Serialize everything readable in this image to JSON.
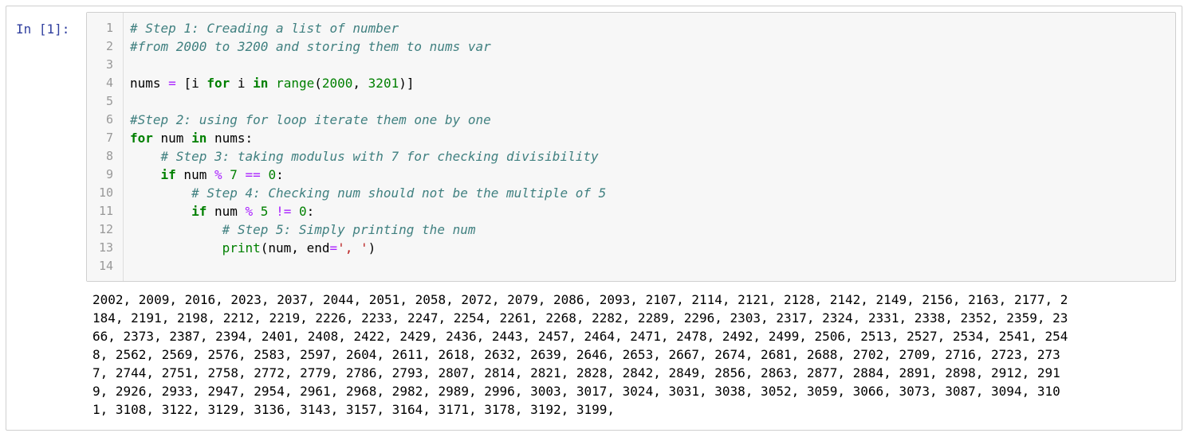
{
  "cell": {
    "prompt": "In [1]:"
  },
  "code": {
    "line_numbers": [
      "1",
      "2",
      "3",
      "4",
      "5",
      "6",
      "7",
      "8",
      "9",
      "10",
      "11",
      "12",
      "13",
      "14"
    ],
    "lines": [
      [
        {
          "t": "# Step 1: Creading a list of number",
          "c": "cm"
        }
      ],
      [
        {
          "t": "#from 2000 to 3200 and storing them to nums var",
          "c": "cm"
        }
      ],
      [],
      [
        {
          "t": "nums ",
          "c": ""
        },
        {
          "t": "=",
          "c": "op"
        },
        {
          "t": " [i ",
          "c": ""
        },
        {
          "t": "for",
          "c": "kw"
        },
        {
          "t": " i ",
          "c": ""
        },
        {
          "t": "in",
          "c": "kw"
        },
        {
          "t": " ",
          "c": ""
        },
        {
          "t": "range",
          "c": "bi"
        },
        {
          "t": "(",
          "c": ""
        },
        {
          "t": "2000",
          "c": "nm"
        },
        {
          "t": ", ",
          "c": ""
        },
        {
          "t": "3201",
          "c": "nm"
        },
        {
          "t": ")]",
          "c": ""
        }
      ],
      [],
      [
        {
          "t": "#Step 2: using for loop iterate them one by one",
          "c": "cm"
        }
      ],
      [
        {
          "t": "for",
          "c": "kw"
        },
        {
          "t": " num ",
          "c": ""
        },
        {
          "t": "in",
          "c": "kw"
        },
        {
          "t": " nums:",
          "c": ""
        }
      ],
      [
        {
          "t": "    ",
          "c": ""
        },
        {
          "t": "# Step 3: taking modulus with 7 for checking divisibility",
          "c": "cm"
        }
      ],
      [
        {
          "t": "    ",
          "c": ""
        },
        {
          "t": "if",
          "c": "kw"
        },
        {
          "t": " num ",
          "c": ""
        },
        {
          "t": "%",
          "c": "op"
        },
        {
          "t": " ",
          "c": ""
        },
        {
          "t": "7",
          "c": "nm"
        },
        {
          "t": " ",
          "c": ""
        },
        {
          "t": "==",
          "c": "op"
        },
        {
          "t": " ",
          "c": ""
        },
        {
          "t": "0",
          "c": "nm"
        },
        {
          "t": ":",
          "c": ""
        }
      ],
      [
        {
          "t": "        ",
          "c": ""
        },
        {
          "t": "# Step 4: Checking num should not be the multiple of 5",
          "c": "cm"
        }
      ],
      [
        {
          "t": "        ",
          "c": ""
        },
        {
          "t": "if",
          "c": "kw"
        },
        {
          "t": " num ",
          "c": ""
        },
        {
          "t": "%",
          "c": "op"
        },
        {
          "t": " ",
          "c": ""
        },
        {
          "t": "5",
          "c": "nm"
        },
        {
          "t": " ",
          "c": ""
        },
        {
          "t": "!=",
          "c": "op"
        },
        {
          "t": " ",
          "c": ""
        },
        {
          "t": "0",
          "c": "nm"
        },
        {
          "t": ":",
          "c": ""
        }
      ],
      [
        {
          "t": "            ",
          "c": ""
        },
        {
          "t": "# Step 5: Simply printing the num",
          "c": "cm"
        }
      ],
      [
        {
          "t": "            ",
          "c": ""
        },
        {
          "t": "print",
          "c": "bi"
        },
        {
          "t": "(num, end",
          "c": ""
        },
        {
          "t": "=",
          "c": "op"
        },
        {
          "t": "', '",
          "c": "st"
        },
        {
          "t": ")",
          "c": ""
        }
      ],
      []
    ]
  },
  "output": {
    "lines": [
      "2002, 2009, 2016, 2023, 2037, 2044, 2051, 2058, 2072, 2079, 2086, 2093, 2107, 2114, 2121, 2128, 2142, 2149, 2156, 2163, 2177, 2",
      "184, 2191, 2198, 2212, 2219, 2226, 2233, 2247, 2254, 2261, 2268, 2282, 2289, 2296, 2303, 2317, 2324, 2331, 2338, 2352, 2359, 23",
      "66, 2373, 2387, 2394, 2401, 2408, 2422, 2429, 2436, 2443, 2457, 2464, 2471, 2478, 2492, 2499, 2506, 2513, 2527, 2534, 2541, 254",
      "8, 2562, 2569, 2576, 2583, 2597, 2604, 2611, 2618, 2632, 2639, 2646, 2653, 2667, 2674, 2681, 2688, 2702, 2709, 2716, 2723, 273",
      "7, 2744, 2751, 2758, 2772, 2779, 2786, 2793, 2807, 2814, 2821, 2828, 2842, 2849, 2856, 2863, 2877, 2884, 2891, 2898, 2912, 291",
      "9, 2926, 2933, 2947, 2954, 2961, 2968, 2982, 2989, 2996, 3003, 3017, 3024, 3031, 3038, 3052, 3059, 3066, 3073, 3087, 3094, 310",
      "1, 3108, 3122, 3129, 3136, 3143, 3157, 3164, 3171, 3178, 3192, 3199,"
    ]
  }
}
